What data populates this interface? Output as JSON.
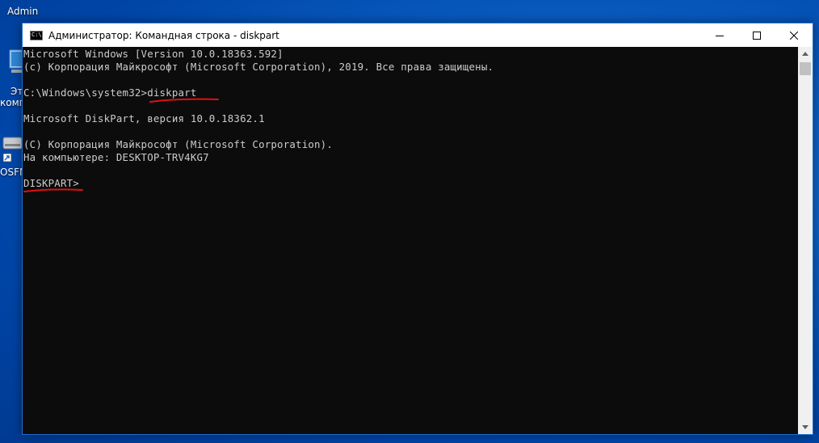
{
  "desktop": {
    "icons": [
      {
        "label": "Admin",
        "icon": "user-folder-icon"
      },
      {
        "label": "Эт\nкомп",
        "icon": "computer-icon"
      },
      {
        "label": "OSFM",
        "icon": "disk-shortcut-icon"
      }
    ]
  },
  "window": {
    "title": "Администратор: Командная строка - diskpart",
    "icon": "cmd-icon",
    "icon_glyph": "C:\\",
    "controls": [
      "minimize-icon",
      "maximize-icon",
      "close-icon"
    ]
  },
  "console": {
    "lines": [
      "Microsoft Windows [Version 10.0.18363.592]",
      "(c) Корпорация Майкрософт (Microsoft Corporation), 2019. Все права защищены.",
      "",
      "C:\\Windows\\system32>diskpart",
      "",
      "Microsoft DiskPart, версия 10.0.18362.1",
      "",
      "(С) Корпорация Майкрософт (Microsoft Corporation).",
      "На компьютере: DESKTOP-TRV4KG7",
      "",
      "DISKPART>"
    ],
    "text_color": "#cccccc",
    "background": "#0c0c0c"
  },
  "annotations": {
    "color": "#e01010"
  }
}
